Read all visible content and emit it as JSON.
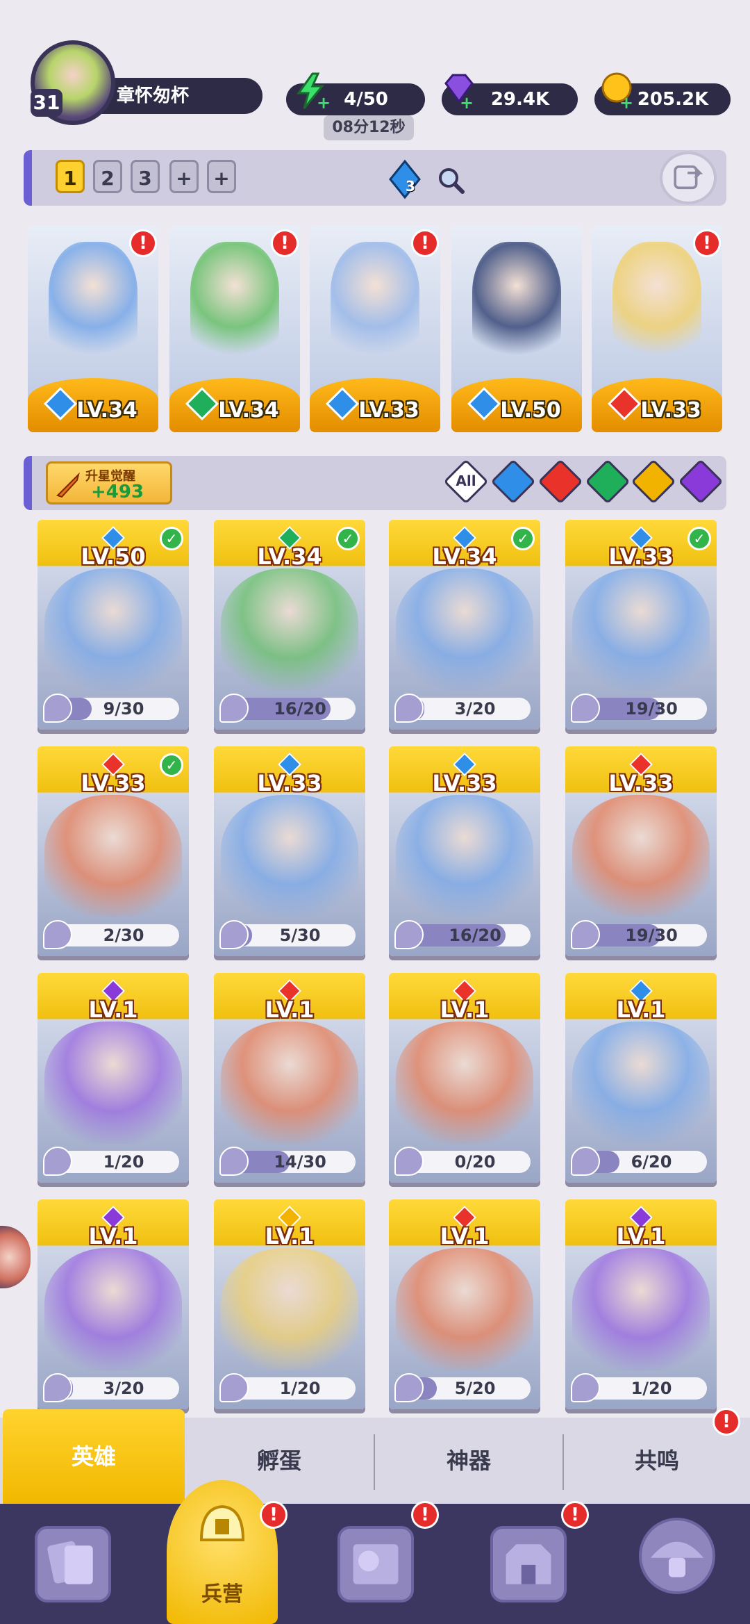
{
  "player": {
    "level": "31",
    "name": "章怀匆杯"
  },
  "resources": {
    "energy": "4/50",
    "energy_timer": "08分12秒",
    "gems": "29.4K",
    "gold": "205.2K"
  },
  "decks": {
    "tabs": [
      "1",
      "2",
      "3",
      "+",
      "+"
    ],
    "selected": "1",
    "crystal_count": "3"
  },
  "team": [
    {
      "level": "LV.34",
      "element": "water",
      "alert": "!"
    },
    {
      "level": "LV.34",
      "element": "wind",
      "alert": "!"
    },
    {
      "level": "LV.33",
      "element": "water",
      "alert": "!"
    },
    {
      "level": "LV.50",
      "element": "water",
      "alert": ""
    },
    {
      "level": "LV.33",
      "element": "fire",
      "alert": "!"
    }
  ],
  "upgrade": {
    "label": "升星觉醒",
    "value": "+493"
  },
  "filters": [
    "All",
    "water",
    "fire",
    "wind",
    "light",
    "dark"
  ],
  "heroes": [
    {
      "level": "LV.50",
      "element": "water",
      "owned_check": true,
      "shards": "9/30",
      "progress": 0.3
    },
    {
      "level": "LV.34",
      "element": "wind",
      "owned_check": true,
      "shards": "16/20",
      "progress": 0.8
    },
    {
      "level": "LV.34",
      "element": "water",
      "owned_check": true,
      "shards": "3/20",
      "progress": 0.15
    },
    {
      "level": "LV.33",
      "element": "water",
      "owned_check": true,
      "shards": "19/30",
      "progress": 0.63
    },
    {
      "level": "LV.33",
      "element": "fire",
      "owned_check": true,
      "shards": "2/30",
      "progress": 0.07
    },
    {
      "level": "LV.33",
      "element": "water",
      "owned_check": false,
      "shards": "5/30",
      "progress": 0.17
    },
    {
      "level": "LV.33",
      "element": "water",
      "owned_check": false,
      "shards": "16/20",
      "progress": 0.8
    },
    {
      "level": "LV.33",
      "element": "fire",
      "owned_check": false,
      "shards": "19/30",
      "progress": 0.63
    },
    {
      "level": "LV.1",
      "element": "dark",
      "owned_check": false,
      "shards": "1/20",
      "progress": 0.05
    },
    {
      "level": "LV.1",
      "element": "fire",
      "owned_check": false,
      "shards": "14/30",
      "progress": 0.47
    },
    {
      "level": "LV.1",
      "element": "fire",
      "owned_check": false,
      "shards": "0/20",
      "progress": 0
    },
    {
      "level": "LV.1",
      "element": "water",
      "owned_check": false,
      "shards": "6/20",
      "progress": 0.3
    },
    {
      "level": "LV.1",
      "element": "dark",
      "owned_check": false,
      "shards": "3/20",
      "progress": 0.15
    },
    {
      "level": "LV.1",
      "element": "light",
      "owned_check": false,
      "shards": "1/20",
      "progress": 0.05
    },
    {
      "level": "LV.1",
      "element": "fire",
      "owned_check": false,
      "shards": "5/20",
      "progress": 0.25
    },
    {
      "level": "LV.1",
      "element": "dark",
      "owned_check": false,
      "shards": "1/20",
      "progress": 0.05
    }
  ],
  "subtabs": [
    {
      "label": "英雄",
      "selected": true,
      "alert": ""
    },
    {
      "label": "孵蛋",
      "selected": false,
      "alert": ""
    },
    {
      "label": "神器",
      "selected": false,
      "alert": ""
    },
    {
      "label": "共鸣",
      "selected": false,
      "alert": "!"
    }
  ],
  "nav": {
    "selected_label": "兵营",
    "alert": "!"
  },
  "colors": {
    "water": "#2f8ee8",
    "wind": "#1fae5a",
    "fire": "#e8322a",
    "light": "#f2b200",
    "dark": "#8a3ad8",
    "accent": "#ffd12e",
    "nav_bg": "#3b3760"
  }
}
